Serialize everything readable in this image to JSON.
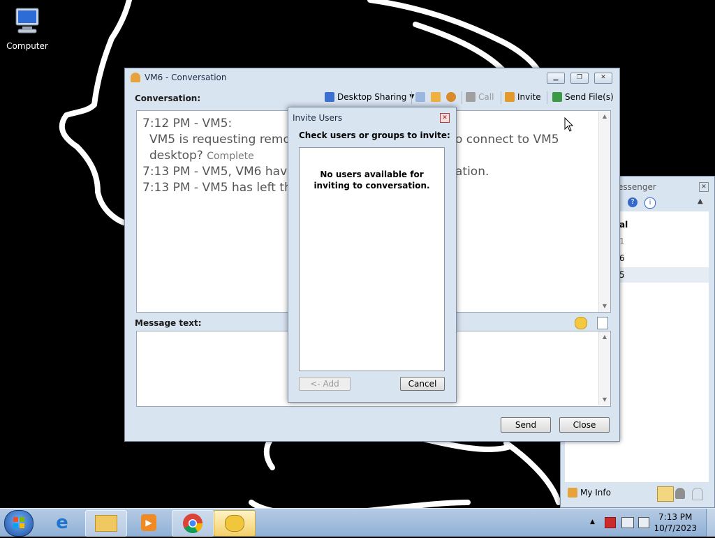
{
  "desktop": {
    "icons": [
      {
        "label": "Computer",
        "icon": "computer-icon"
      }
    ]
  },
  "conversation_window": {
    "title": "VM6 - Conversation",
    "conversation_label": "Conversation:",
    "toolbar": {
      "desktop_sharing": "Desktop Sharing",
      "call": "Call",
      "invite": "Invite",
      "send_files": "Send File(s)"
    },
    "log": [
      {
        "prefix": "7:12 PM - VM5:",
        "text": ""
      },
      {
        "prefix": "VM5 is requesting remot",
        "text": "o connect to VM5"
      },
      {
        "prefix": "desktop?",
        "status": "Complete"
      },
      {
        "prefix": "7:13 PM - VM5, VM6 have",
        "text": "ation."
      },
      {
        "prefix": "7:13 PM - VM5 has left th",
        "text": ""
      }
    ],
    "message_label": "Message text:",
    "message_value": "",
    "send_button": "Send",
    "close_button": "Close"
  },
  "invite_dialog": {
    "title": "Invite Users",
    "prompt": "Check users or groups to invite:",
    "empty_message": "No users available for inviting to conversation.",
    "add_button": "<- Add",
    "cancel_button": "Cancel"
  },
  "messenger_window": {
    "title_partial": "essenger",
    "items": [
      "al",
      "1",
      "6",
      "5"
    ],
    "my_info": "My Info"
  },
  "taskbar": {
    "apps": [
      "start-orb",
      "internet-explorer",
      "file-explorer",
      "media-player",
      "chrome",
      "messenger"
    ],
    "clock_time": "7:13 PM",
    "clock_date": "10/7/2023"
  },
  "colors": {
    "window_bg": "#d9e4f1",
    "desktop_bg": "#000000",
    "taskbar": "#9fbbdc",
    "active_task": "#f4d06a"
  }
}
